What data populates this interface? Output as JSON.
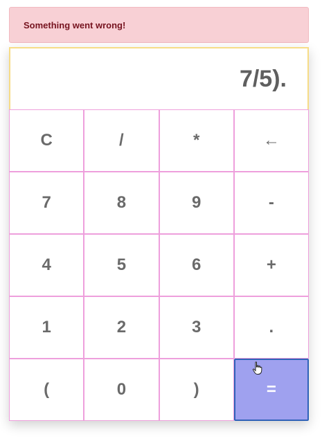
{
  "error": {
    "message": "Something went wrong!"
  },
  "display": {
    "value": "7/5)."
  },
  "keys": [
    {
      "label": "C"
    },
    {
      "label": "/"
    },
    {
      "label": "*"
    },
    {
      "label": "←"
    },
    {
      "label": "7"
    },
    {
      "label": "8"
    },
    {
      "label": "9"
    },
    {
      "label": "-"
    },
    {
      "label": "4"
    },
    {
      "label": "5"
    },
    {
      "label": "6"
    },
    {
      "label": "+"
    },
    {
      "label": "1"
    },
    {
      "label": "2"
    },
    {
      "label": "3"
    },
    {
      "label": "."
    },
    {
      "label": "("
    },
    {
      "label": "0"
    },
    {
      "label": ")"
    },
    {
      "label": "="
    }
  ],
  "colors": {
    "error_bg": "#f8d0d5",
    "error_text": "#76131f",
    "display_border": "#f7dc86",
    "key_border": "#ee9fdc",
    "equals_bg": "#9fa1ef",
    "equals_border": "#2f62b8"
  }
}
